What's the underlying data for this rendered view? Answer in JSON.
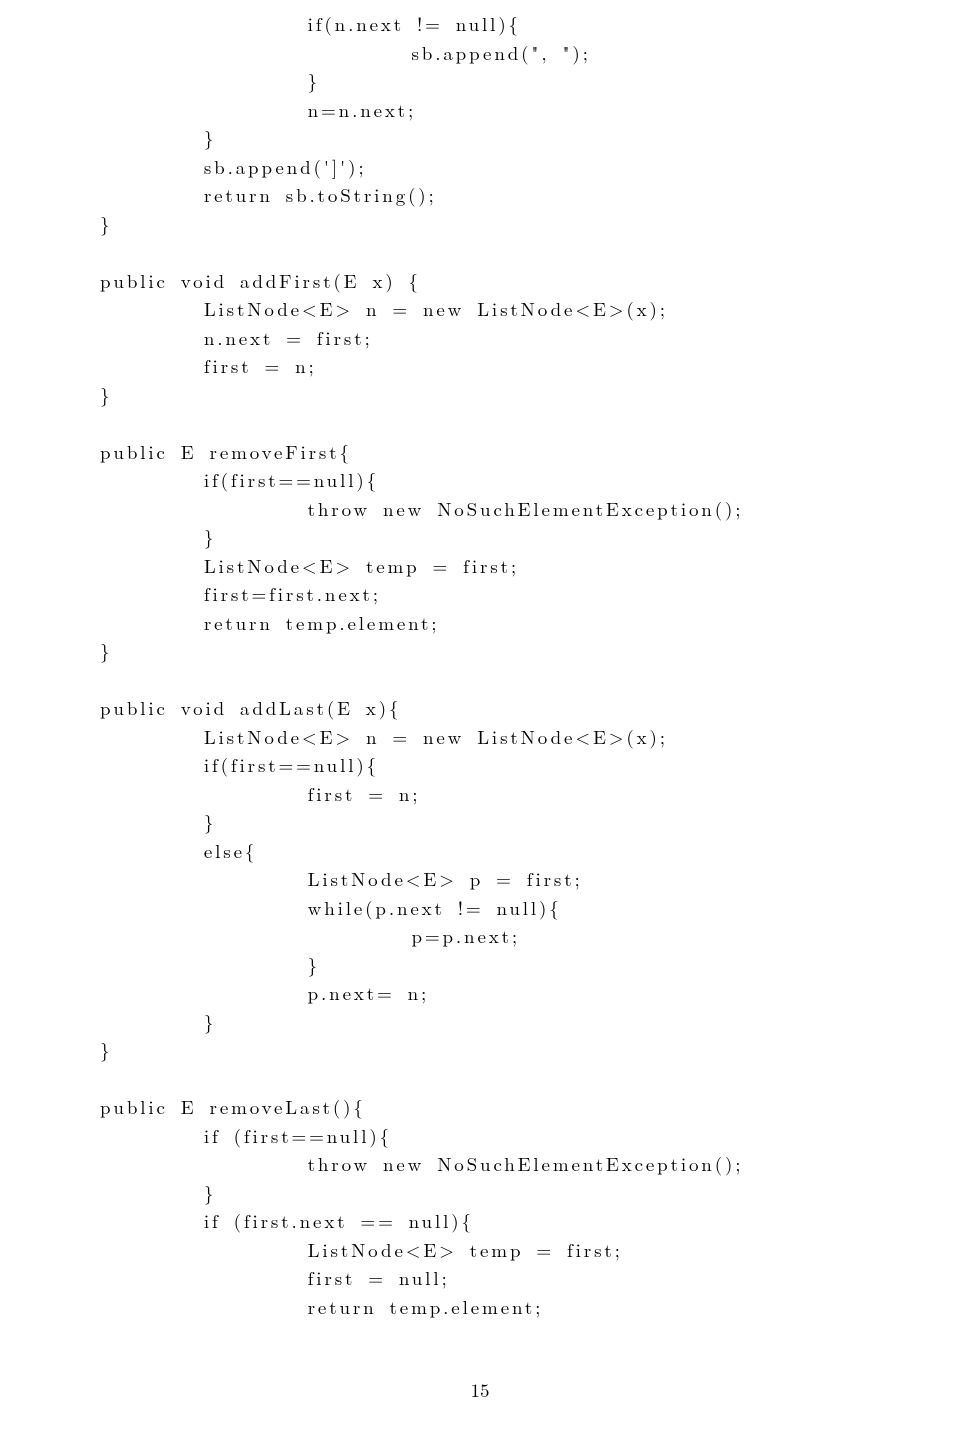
{
  "code": {
    "lines": [
      "                if(n.next != null){",
      "                        sb.append(\", \");",
      "                }",
      "                n=n.next;",
      "        }",
      "        sb.append(']');",
      "        return sb.toString();",
      "}",
      "",
      "public void addFirst(E x) {",
      "        ListNode<E> n = new ListNode<E>(x);",
      "        n.next = first;",
      "        first = n;",
      "}",
      "",
      "public E removeFirst{",
      "        if(first==null){",
      "                throw new NoSuchElementException();",
      "        }",
      "        ListNode<E> temp = first;",
      "        first=first.next;",
      "        return temp.element;",
      "}",
      "",
      "public void addLast(E x){",
      "        ListNode<E> n = new ListNode<E>(x);",
      "        if(first==null){",
      "                first = n;",
      "        }",
      "        else{",
      "                ListNode<E> p = first;",
      "                while(p.next != null){",
      "                        p=p.next;",
      "                }",
      "                p.next= n;",
      "        }",
      "}",
      "",
      "public E removeLast(){",
      "        if (first==null){",
      "                throw new NoSuchElementException();",
      "        }",
      "        if (first.next == null){",
      "                ListNode<E> temp = first;",
      "                first = null;",
      "                return temp.element;"
    ]
  },
  "page_number": "15"
}
